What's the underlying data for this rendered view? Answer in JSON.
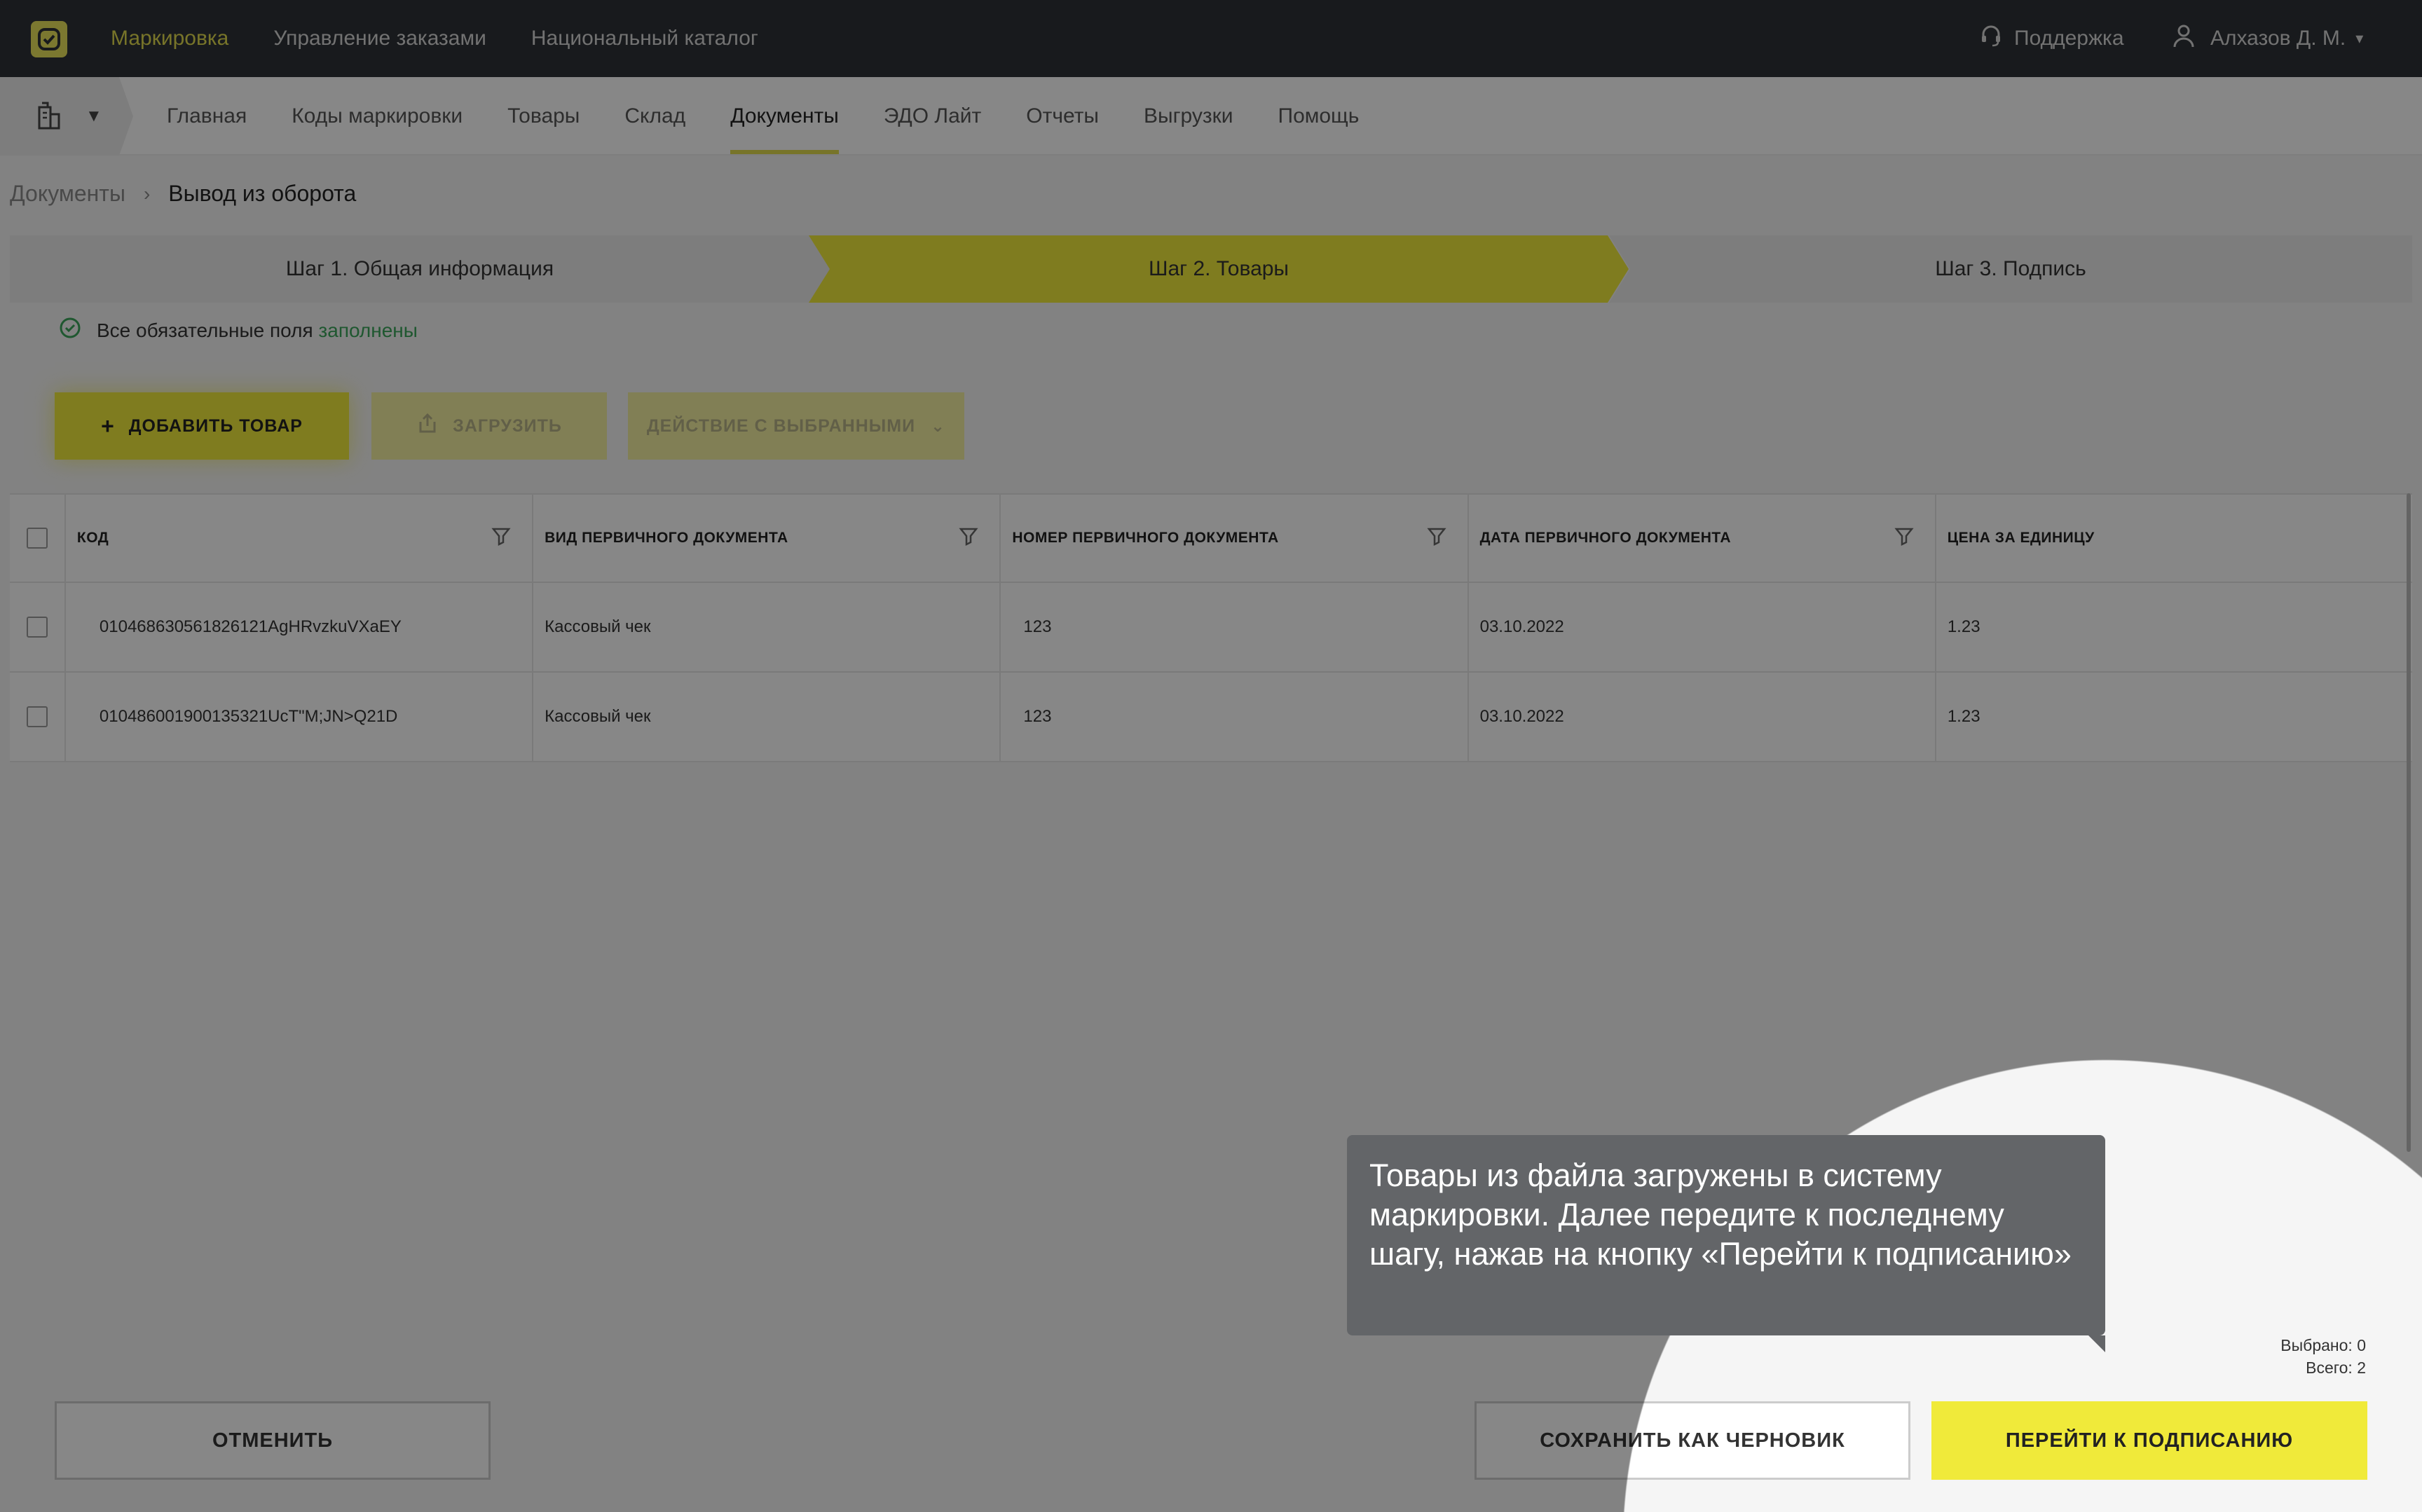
{
  "topbar": {
    "nav": [
      "Маркировка",
      "Управление заказами",
      "Национальный каталог"
    ],
    "support": "Поддержка",
    "user": "Алхазов Д. М."
  },
  "subnav": {
    "items": [
      "Главная",
      "Коды маркировки",
      "Товары",
      "Склад",
      "Документы",
      "ЭДО Лайт",
      "Отчеты",
      "Выгрузки",
      "Помощь"
    ],
    "active": "Документы"
  },
  "breadcrumb": {
    "parent": "Документы",
    "current": "Вывод из оборота"
  },
  "steps": [
    "Шаг 1. Общая информация",
    "Шаг 2. Товары",
    "Шаг 3. Подпись"
  ],
  "status": {
    "text": "Все обязательные поля",
    "highlight": "заполнены"
  },
  "actions": {
    "add": "ДОБАВИТЬ ТОВАР",
    "upload": "ЗАГРУЗИТЬ",
    "bulk": "ДЕЙСТВИЕ С ВЫБРАННЫМИ"
  },
  "table": {
    "columns": [
      "КОД",
      "ВИД ПЕРВИЧНОГО ДОКУМЕНТА",
      "НОМЕР ПЕРВИЧНОГО ДОКУМЕНТА",
      "ДАТА ПЕРВИЧНОГО ДОКУМЕНТА",
      "ЦЕНА ЗА ЕДИНИЦУ"
    ],
    "rows": [
      [
        "010468630561826121AgHRvzkuVXaEY",
        "Кассовый чек",
        "123",
        "03.10.2022",
        "1.23"
      ],
      [
        "010486001900135321UcT\"M;JN>Q21D",
        "Кассовый чек",
        "123",
        "03.10.2022",
        "1.23"
      ]
    ]
  },
  "counts": {
    "selected": "Выбрано: 0",
    "total": "Всего: 2"
  },
  "footer": {
    "cancel": "ОТМЕНИТЬ",
    "draft": "СОХРАНИТЬ КАК ЧЕРНОВИК",
    "sign": "ПЕРЕЙТИ К ПОДПИСАНИЮ"
  },
  "tooltip": "Товары из файла загружены в систему маркировки. Далее передите к последнему шагу, нажав на кнопку «Перейти к подписанию»",
  "colors": {
    "accent": "#f0ea3a",
    "topbar": "#2e3236",
    "ok": "#3aa55a"
  },
  "icons": [
    "logo-icon",
    "headset-icon",
    "user-icon",
    "building-icon",
    "check-circle-icon",
    "plus-icon",
    "upload-icon",
    "chevron-down-icon",
    "filter-icon"
  ]
}
